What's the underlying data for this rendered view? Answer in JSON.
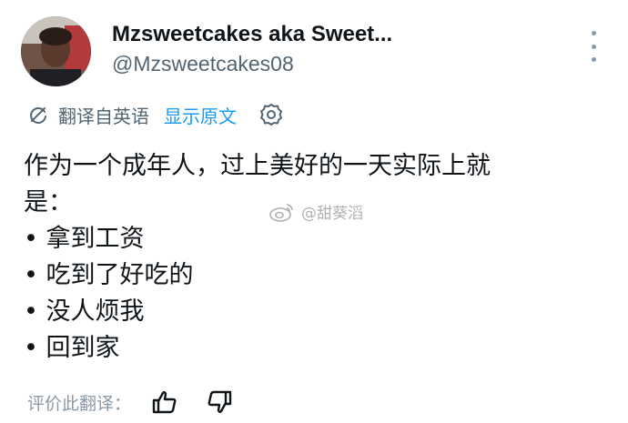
{
  "author": {
    "display_name": "Mzsweetcakes aka Sweet...",
    "handle": "@Mzsweetcakes08",
    "avatar_icon": "profile-photo"
  },
  "header": {
    "more_icon": "vertical-ellipsis-icon"
  },
  "translation": {
    "translated_label": "翻译自英语",
    "show_original_label": "显示原文",
    "translate_icon": "translate-icon",
    "settings_icon": "gear-icon"
  },
  "tweet": {
    "lines": [
      "作为一个成年人，过上美好的一天实际上就",
      "是：",
      "• 拿到工资",
      "• 吃到了好吃的",
      "• 没人烦我",
      "• 回到家"
    ]
  },
  "watermark": {
    "text": "@甜葵滔",
    "logo_icon": "weibo-logo"
  },
  "rating": {
    "label": "评价此翻译：",
    "up_icon": "thumbs-up-icon",
    "down_icon": "thumbs-down-icon"
  },
  "colors": {
    "text_primary": "#0f1419",
    "text_secondary": "#536471",
    "link": "#1d9bf0",
    "muted": "#8b98a5"
  }
}
